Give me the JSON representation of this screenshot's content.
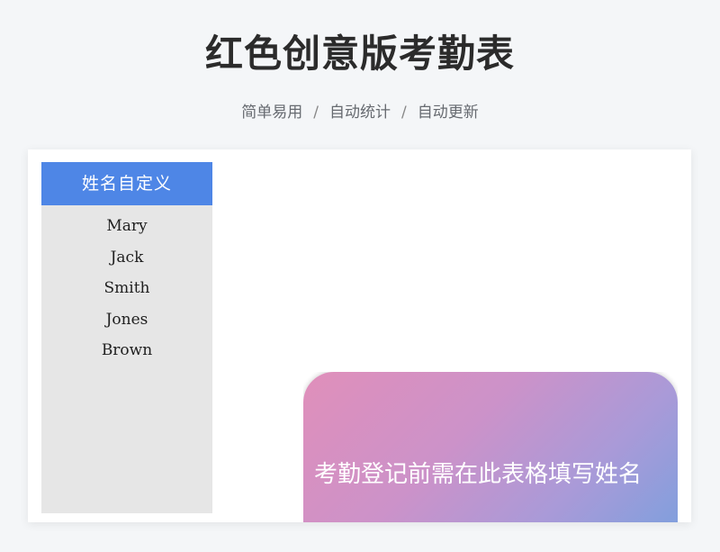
{
  "header": {
    "title": "红色创意版考勤表",
    "subtitle_items": [
      "简单易用",
      "自动统计",
      "自动更新"
    ],
    "separator": "/"
  },
  "name_panel": {
    "title": "姓名自定义",
    "names": [
      "Mary",
      "Jack",
      "Smith",
      "Jones",
      "Brown"
    ]
  },
  "tip": {
    "text": "考勤登记前需在此表格填写姓名"
  }
}
